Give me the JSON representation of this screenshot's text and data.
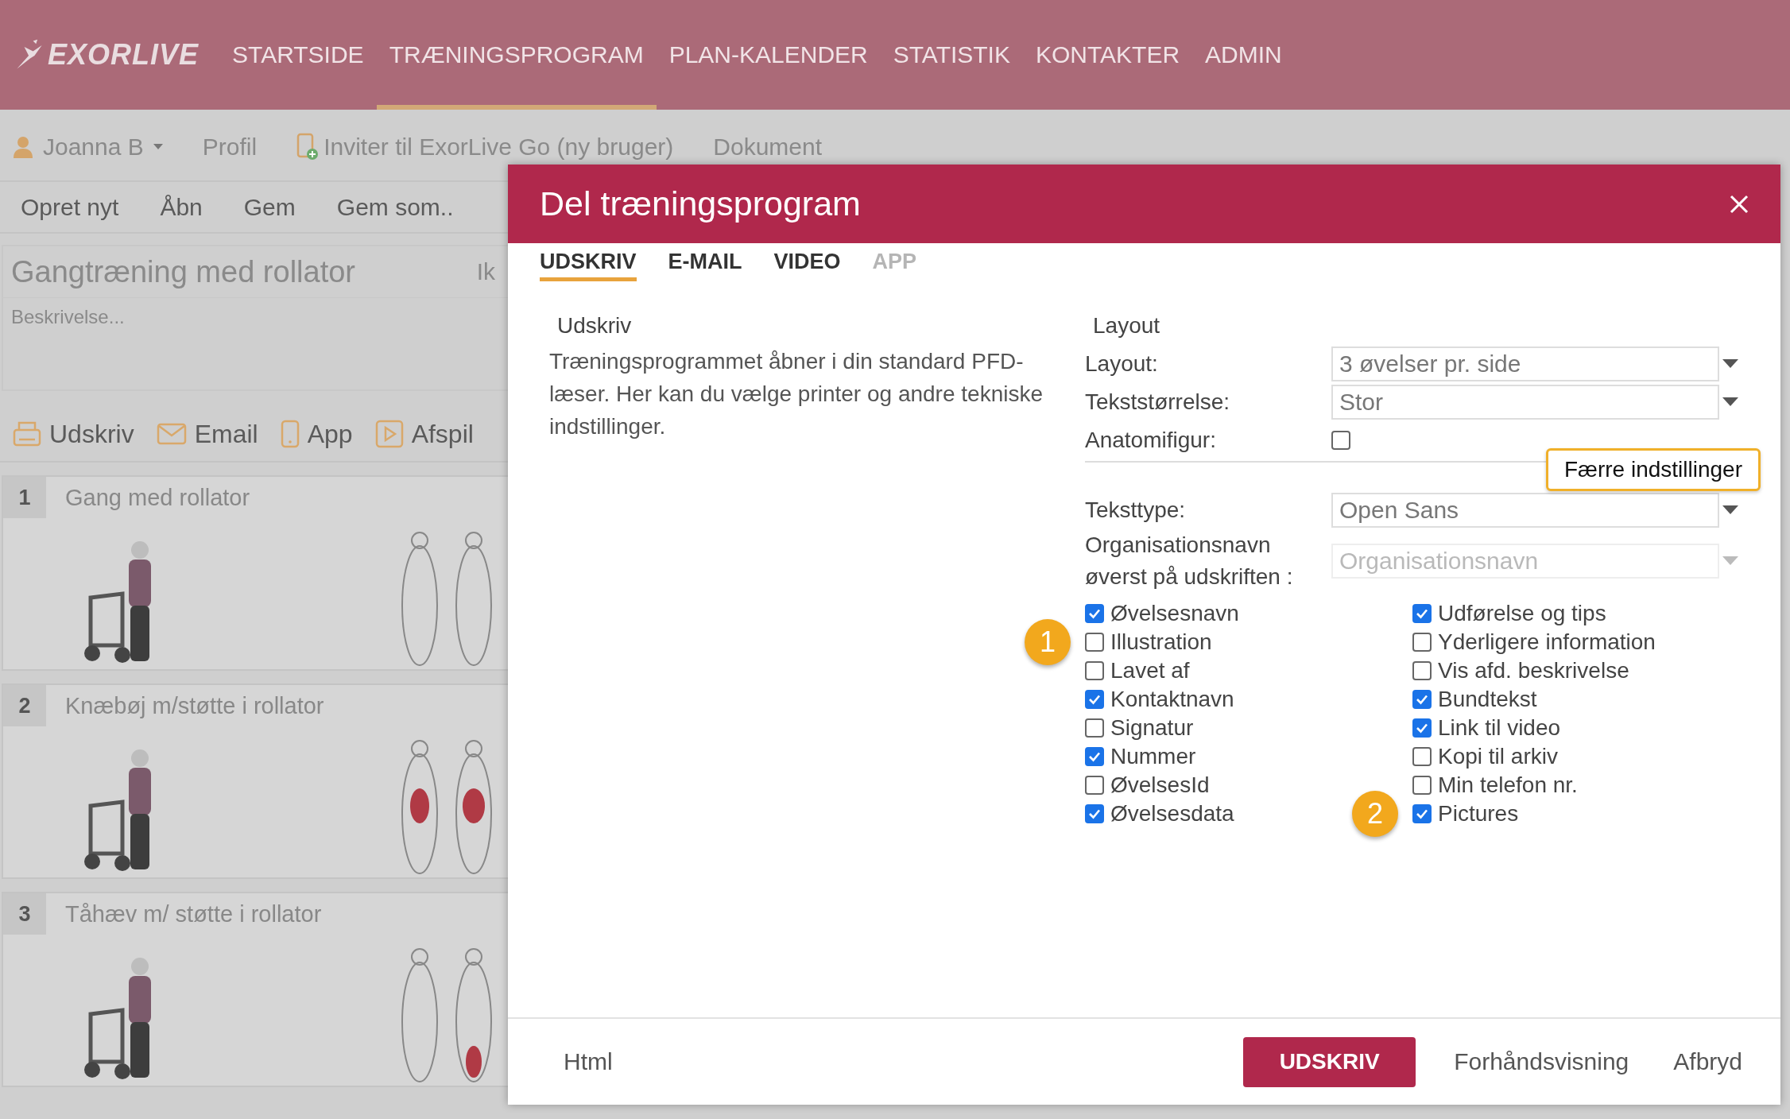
{
  "nav": {
    "logo": "EXORLIVE",
    "items": [
      {
        "label": "STARTSIDE",
        "selected": false
      },
      {
        "label": "TRÆNINGSPROGRAM",
        "selected": true
      },
      {
        "label": "PLAN-KALENDER",
        "selected": false
      },
      {
        "label": "STATISTIK",
        "selected": false
      },
      {
        "label": "KONTAKTER",
        "selected": false
      },
      {
        "label": "ADMIN",
        "selected": false
      }
    ]
  },
  "user_bar": {
    "user": "Joanna B",
    "profile": "Profil",
    "invite": "Inviter til ExorLive Go (ny bruger)",
    "document": "Dokument"
  },
  "toolbar": [
    "Opret nyt",
    "Åbn",
    "Gem",
    "Gem som.."
  ],
  "program": {
    "title": "Gangtræning med rollator",
    "column_2": "Ik",
    "description_placeholder": "Beskrivelse..."
  },
  "actions": [
    {
      "label": "Udskriv",
      "kind": "print"
    },
    {
      "label": "Email",
      "kind": "email"
    },
    {
      "label": "App",
      "kind": "app"
    },
    {
      "label": "Afspil",
      "kind": "play"
    }
  ],
  "exercises": [
    {
      "number": "1",
      "name": "Gang med rollator"
    },
    {
      "number": "2",
      "name": "Knæbøj m/støtte i rollator"
    },
    {
      "number": "3",
      "name": "Tåhæv m/ støtte i rollator"
    }
  ],
  "dialog": {
    "title": "Del træningsprogram",
    "tabs": [
      {
        "label": "UDSKRIV",
        "selected": true,
        "disabled": false
      },
      {
        "label": "E-MAIL",
        "selected": false,
        "disabled": false
      },
      {
        "label": "VIDEO",
        "selected": false,
        "disabled": false
      },
      {
        "label": "APP",
        "selected": false,
        "disabled": true
      }
    ],
    "intro": {
      "heading": "Udskriv",
      "text": "Træningsprogrammet åbner i din standard PFD-læser. Her kan du vælge printer og andre tekniske indstillinger."
    },
    "layout": {
      "heading": "Layout",
      "fields": [
        {
          "label": "Layout:",
          "kind": "select",
          "value": "3 øvelser pr. side",
          "disabled": false
        },
        {
          "label": "Tekststørrelse:",
          "kind": "select",
          "value": "Stor",
          "disabled": false
        },
        {
          "label": "Anatomifigur:",
          "kind": "checkbox",
          "checked": false
        }
      ],
      "toggle_button": {
        "label": "Færre indstillinger",
        "highlighted": true
      },
      "more_fields": [
        {
          "label": "Teksttype:",
          "kind": "select",
          "value": "Open Sans",
          "disabled": false
        },
        {
          "label": "Organisationsnavn øverst på udskriften :",
          "kind": "select",
          "placeholder": "Organisationsnavn",
          "disabled": true
        }
      ],
      "options_left": [
        {
          "label": "Øvelsesnavn",
          "checked": true
        },
        {
          "label": "Illustration",
          "checked": false,
          "marker": "1"
        },
        {
          "label": "Lavet af",
          "checked": false
        },
        {
          "label": "Kontaktnavn",
          "checked": true
        },
        {
          "label": "Signatur",
          "checked": false
        },
        {
          "label": "Nummer",
          "checked": true
        },
        {
          "label": "ØvelsesId",
          "checked": false
        },
        {
          "label": "Øvelsesdata",
          "checked": true
        }
      ],
      "options_right": [
        {
          "label": "Udførelse og tips",
          "checked": true
        },
        {
          "label": "Yderligere information",
          "checked": false
        },
        {
          "label": "Vis afd. beskrivelse",
          "checked": false
        },
        {
          "label": "Bundtekst",
          "checked": true
        },
        {
          "label": "Link til video",
          "checked": true
        },
        {
          "label": "Kopi til arkiv",
          "checked": false
        },
        {
          "label": "Min telefon nr.",
          "checked": false
        },
        {
          "label": "Pictures",
          "checked": true,
          "marker": "2"
        }
      ]
    },
    "footer": {
      "link": "Html",
      "primary": "UDSKRIV",
      "buttons": [
        "Forhåndsvisning",
        "Afbryd"
      ]
    }
  }
}
